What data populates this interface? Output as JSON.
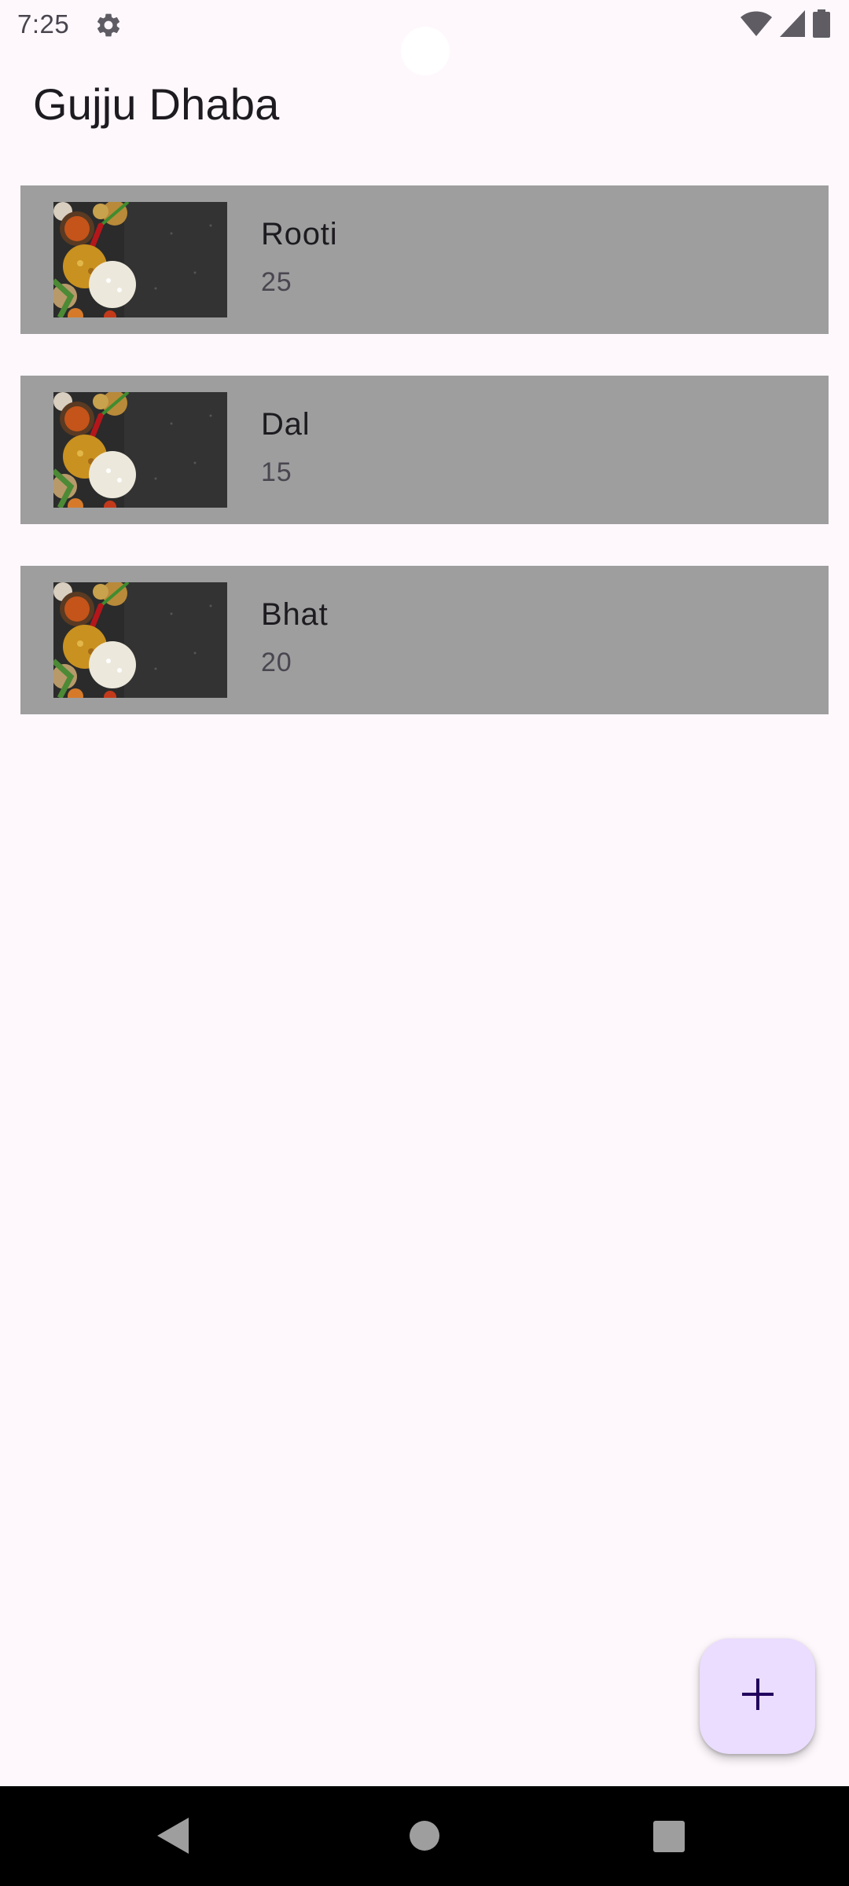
{
  "status_bar": {
    "time": "7:25",
    "icons": [
      "settings-icon",
      "wifi-icon",
      "cell-signal-icon",
      "battery-icon"
    ]
  },
  "app_bar": {
    "title": "Gujju Dhaba"
  },
  "food_items": [
    {
      "name": "Rooti",
      "price": "25",
      "image": "food-thali-image"
    },
    {
      "name": "Dal",
      "price": "15",
      "image": "food-thali-image"
    },
    {
      "name": "Bhat",
      "price": "20",
      "image": "food-thali-image"
    }
  ],
  "fab": {
    "icon": "plus-icon"
  },
  "nav_bar": {
    "icons": [
      "back-icon",
      "home-icon",
      "recents-icon"
    ]
  },
  "colors": {
    "background": "#fef8fc",
    "card": "#9e9e9e",
    "fab": "#eaddff",
    "fab_icon": "#21005d",
    "nav_bar": "#000000"
  }
}
